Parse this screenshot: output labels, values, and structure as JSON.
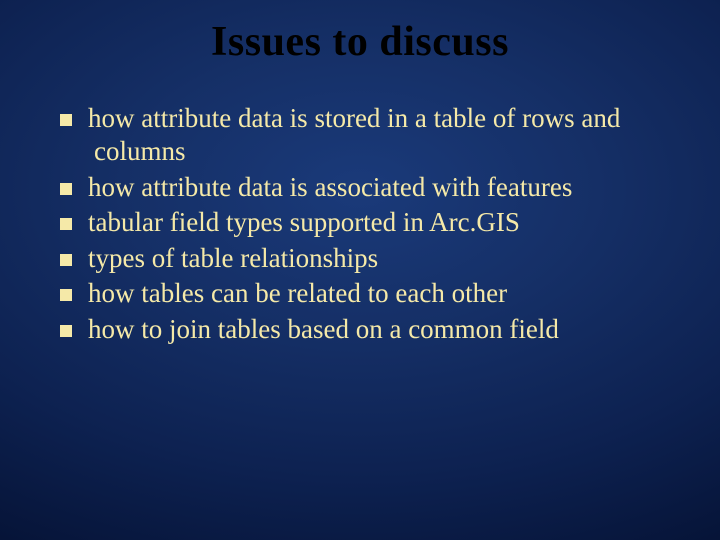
{
  "slide": {
    "title": "Issues to discuss",
    "bullets": [
      "how attribute data is stored in a table of rows and columns",
      "how attribute data is associated with features",
      "tabular field types supported in Arc.GIS",
      "types of table relationships",
      "how tables can be related to each other",
      "how to join tables based on a common field"
    ]
  }
}
